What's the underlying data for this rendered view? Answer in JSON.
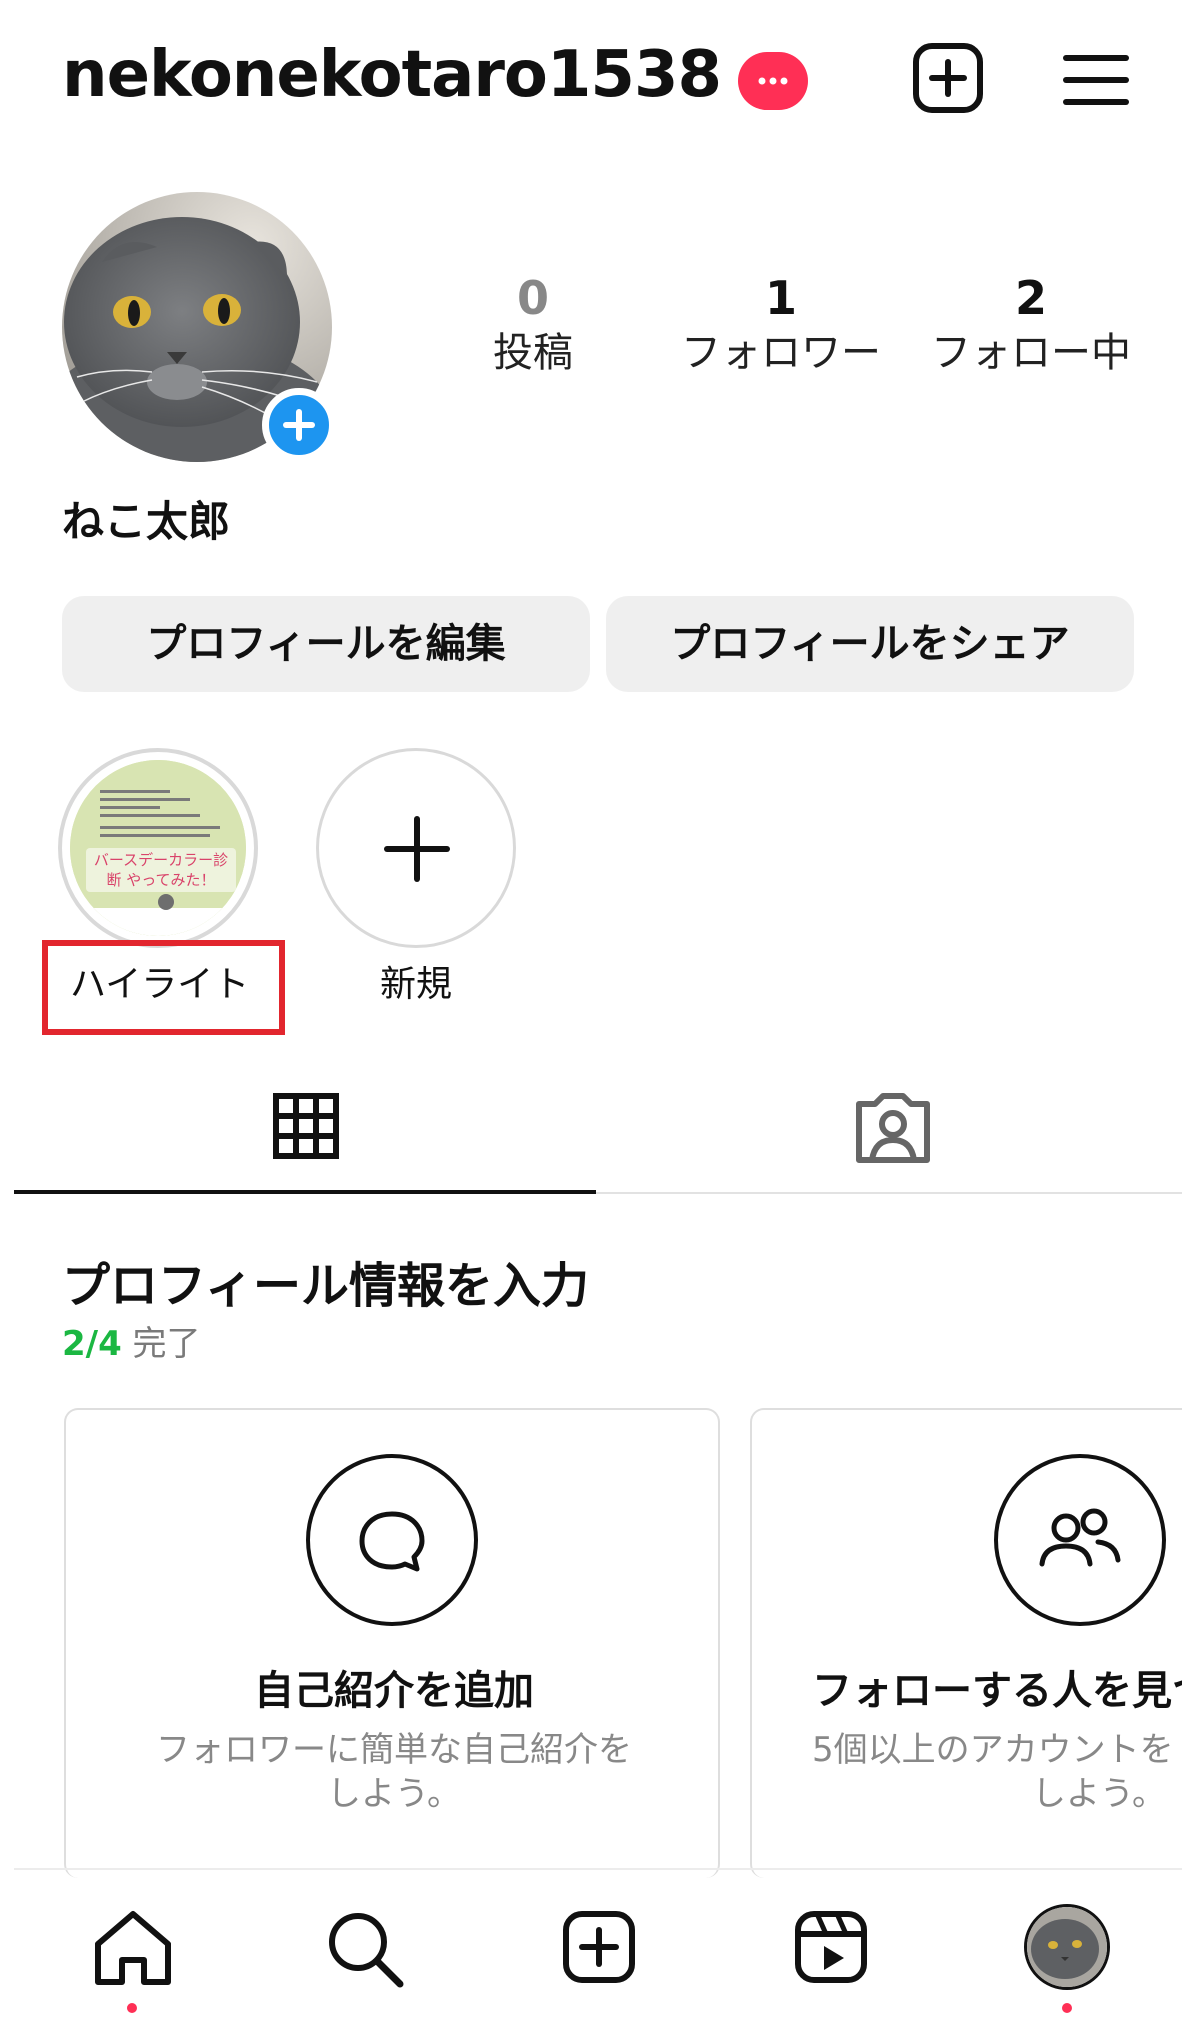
{
  "header": {
    "username": "nekonekotaro1538",
    "notification_badge": "•••",
    "accent_color": "#ff2f55",
    "create_icon": "plus-square-icon",
    "menu_icon": "hamburger-menu-icon"
  },
  "profile": {
    "display_name": "ねこ太郎",
    "stats": [
      {
        "value": "0",
        "label": "投稿"
      },
      {
        "value": "1",
        "label": "フォロワー"
      },
      {
        "value": "2",
        "label": "フォロー中"
      }
    ],
    "edit_button": "プロフィールを編集",
    "share_button": "プロフィールをシェア"
  },
  "highlights": [
    {
      "label": "ハイライト",
      "cover_text": "バースデーカラー診断 やってみた！"
    },
    {
      "label": "新規"
    }
  ],
  "tabs": [
    {
      "icon": "grid-icon",
      "active": true
    },
    {
      "icon": "tagged-person-icon",
      "active": false
    }
  ],
  "profile_info": {
    "title": "プロフィール情報を入力",
    "progress_value": "2/4",
    "progress_text": "完了",
    "progress_color": "#1bb742",
    "cards": [
      {
        "icon": "speech-bubble-icon",
        "title": "自己紹介を追加",
        "desc_line1": "フォロワーに簡単な自己紹介を",
        "desc_line2": "しよう。"
      },
      {
        "icon": "people-icon",
        "title": "フォローする人を見つ",
        "desc_line1": "5個以上のアカウントを",
        "desc_line2": "しよう。"
      }
    ]
  },
  "bottom_nav": [
    {
      "icon": "home-icon"
    },
    {
      "icon": "search-icon"
    },
    {
      "icon": "create-icon"
    },
    {
      "icon": "reels-icon"
    },
    {
      "icon": "profile-avatar-icon"
    }
  ]
}
